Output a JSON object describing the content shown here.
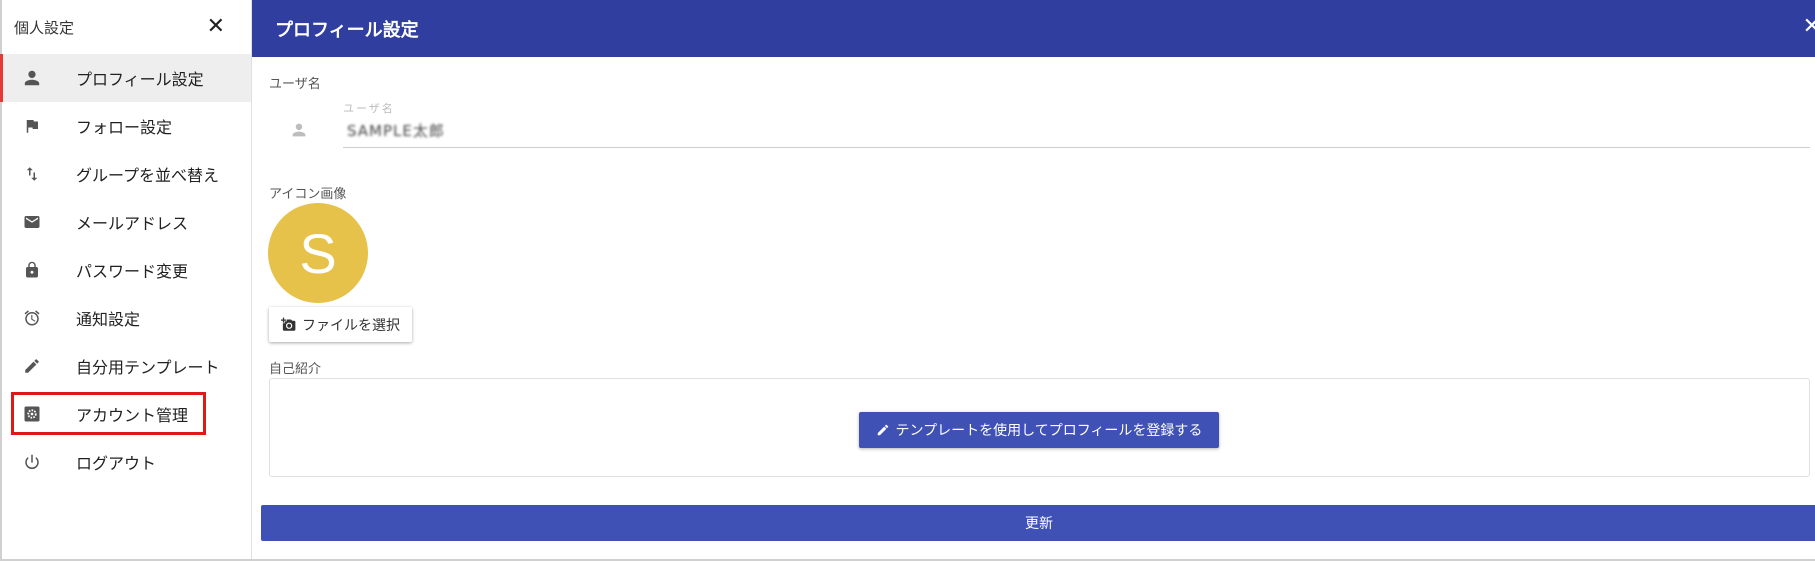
{
  "sidebar": {
    "title": "個人設定",
    "close_icon": "close-icon",
    "items": [
      {
        "label": "プロフィール設定",
        "icon": "person-icon"
      },
      {
        "label": "フォロー設定",
        "icon": "flag-icon"
      },
      {
        "label": "グループを並べ替え",
        "icon": "swap-vert-icon"
      },
      {
        "label": "メールアドレス",
        "icon": "mail-icon"
      },
      {
        "label": "パスワード変更",
        "icon": "lock-icon"
      },
      {
        "label": "通知設定",
        "icon": "alarm-icon"
      },
      {
        "label": "自分用テンプレート",
        "icon": "pencil-icon"
      },
      {
        "label": "アカウント管理",
        "icon": "gear-icon"
      },
      {
        "label": "ログアウト",
        "icon": "power-icon"
      }
    ]
  },
  "main": {
    "title": "プロフィール設定",
    "username_label": "ユーザ名",
    "username_caption": "ユーザ名",
    "username_value": "SAMPLE太郎",
    "icon_label": "アイコン画像",
    "avatar_letter": "S",
    "file_button": "ファイルを選択",
    "intro_label": "自己紹介",
    "template_button": "テンプレートを使用してプロフィールを登録する",
    "update_button": "更新"
  },
  "colors": {
    "header": "#303f9f",
    "primary_button": "#3f51b5",
    "avatar": "#e6c24a",
    "highlight": "#e01818",
    "active_marker": "#e53935"
  }
}
